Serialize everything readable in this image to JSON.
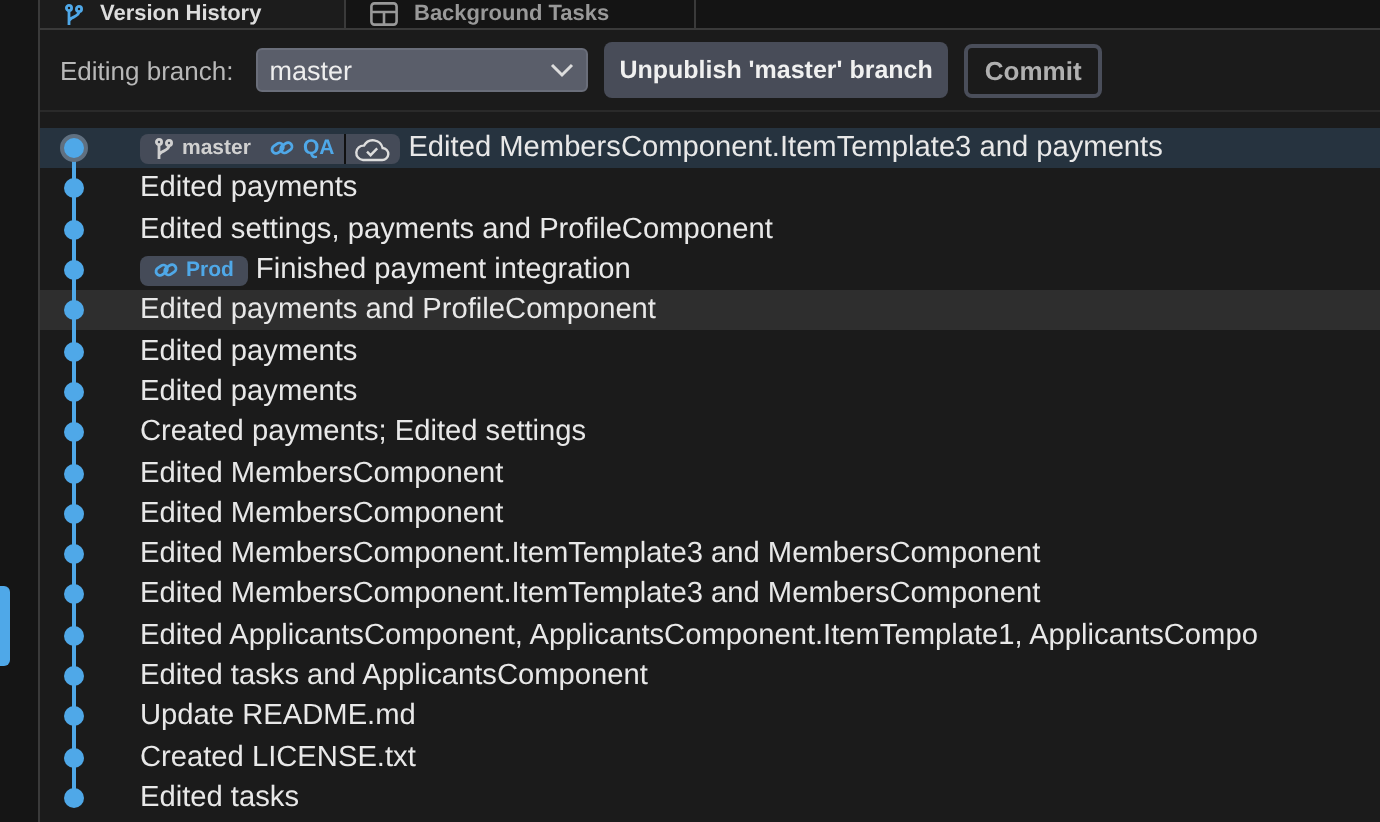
{
  "tabs": [
    {
      "label": "Version History",
      "selected": true
    },
    {
      "label": "Background Tasks",
      "selected": false
    }
  ],
  "toolbar": {
    "label": "Editing branch:",
    "branch_select": {
      "value": "master"
    },
    "buttons": [
      {
        "label": "Unpublish 'master' branch",
        "kind": "primary"
      },
      {
        "label": "Commit",
        "kind": "outline"
      }
    ]
  },
  "commits": [
    {
      "message": "Edited MembersComponent.ItemTemplate3 and payments",
      "selected": true,
      "hovered": false,
      "tags": [
        {
          "kind": "branch",
          "label": "master"
        },
        {
          "kind": "deploy",
          "label": "QA"
        }
      ],
      "published": true
    },
    {
      "message": "Edited payments",
      "selected": false,
      "hovered": false
    },
    {
      "message": "Edited settings, payments and ProfileComponent",
      "selected": false,
      "hovered": false
    },
    {
      "message": "Finished payment integration",
      "selected": false,
      "hovered": false,
      "tags": [
        {
          "kind": "deploy",
          "label": "Prod"
        }
      ]
    },
    {
      "message": "Edited payments and ProfileComponent",
      "selected": false,
      "hovered": true
    },
    {
      "message": "Edited payments",
      "selected": false,
      "hovered": false
    },
    {
      "message": "Edited payments",
      "selected": false,
      "hovered": false
    },
    {
      "message": "Created payments; Edited settings",
      "selected": false,
      "hovered": false
    },
    {
      "message": "Edited MembersComponent",
      "selected": false,
      "hovered": false
    },
    {
      "message": "Edited MembersComponent",
      "selected": false,
      "hovered": false
    },
    {
      "message": "Edited MembersComponent.ItemTemplate3 and MembersComponent",
      "selected": false,
      "hovered": false
    },
    {
      "message": "Edited MembersComponent.ItemTemplate3 and MembersComponent",
      "selected": false,
      "hovered": false
    },
    {
      "message": "Edited ApplicantsComponent, ApplicantsComponent.ItemTemplate1, ApplicantsCompo",
      "selected": false,
      "hovered": false
    },
    {
      "message": "Edited tasks and ApplicantsComponent",
      "selected": false,
      "hovered": false
    },
    {
      "message": "Update README.md",
      "selected": false,
      "hovered": false
    },
    {
      "message": "Created LICENSE.txt",
      "selected": false,
      "hovered": false
    },
    {
      "message": "Edited tasks",
      "selected": false,
      "hovered": false
    }
  ]
}
